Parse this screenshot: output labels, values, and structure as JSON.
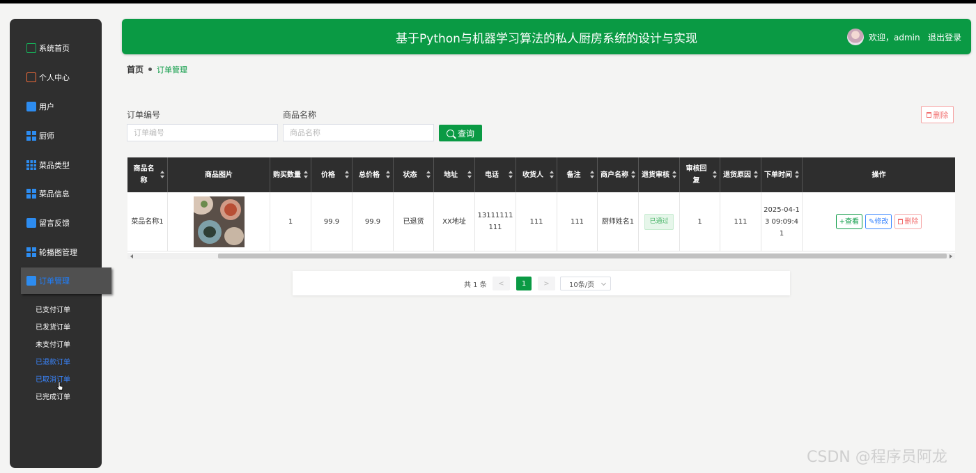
{
  "header": {
    "title": "基于Python与机器学习算法的私人厨房系统的设计与实现",
    "welcome": "欢迎，admin",
    "logout": "退出登录"
  },
  "sidebar": {
    "items": [
      {
        "label": "系统首页",
        "icon": "home-icon"
      },
      {
        "label": "个人中心",
        "icon": "card-icon"
      },
      {
        "label": "用户",
        "icon": "briefcase-icon"
      },
      {
        "label": "厨师",
        "icon": "grid-icon"
      },
      {
        "label": "菜品类型",
        "icon": "grid-icon"
      },
      {
        "label": "菜品信息",
        "icon": "grid-icon"
      },
      {
        "label": "留言反馈",
        "icon": "clipboard-icon"
      },
      {
        "label": "轮播图管理",
        "icon": "grid-icon"
      },
      {
        "label": "订单管理",
        "icon": "clipboard-icon"
      }
    ],
    "subitems": [
      "已支付订单",
      "已发货订单",
      "未支付订单",
      "已退款订单",
      "已取消订单",
      "已完成订单"
    ]
  },
  "breadcrumb": {
    "home": "首页",
    "current": "订单管理"
  },
  "search": {
    "order_no_label": "订单编号",
    "order_no_placeholder": "订单编号",
    "product_label": "商品名称",
    "product_placeholder": "商品名称",
    "search_button": "查询",
    "delete_button": "删除"
  },
  "table": {
    "headers": [
      "商品名称",
      "商品图片",
      "购买数量",
      "价格",
      "总价格",
      "状态",
      "地址",
      "电话",
      "收货人",
      "备注",
      "商户名称",
      "退货审核",
      "审核回复",
      "退货原因",
      "下单时间",
      "操作"
    ],
    "rows": [
      {
        "product_name": "菜品名称1",
        "quantity": "1",
        "price": "99.9",
        "total": "99.9",
        "status": "已退货",
        "address": "XX地址",
        "phone": "13111111111",
        "receiver": "111",
        "remark": "111",
        "merchant": "厨师姓名1",
        "return_review": "已通过",
        "review_reply": "1",
        "return_reason": "111",
        "order_time": "2025-04-13 09:09:41",
        "actions": {
          "view": "查看",
          "edit": "修改",
          "delete": "删除"
        }
      }
    ]
  },
  "pagination": {
    "total": "共 1 条",
    "prev": "<",
    "page": "1",
    "next": ">",
    "page_size": "10条/页"
  },
  "watermark": "CSDN @程序员阿龙",
  "colors": {
    "primary": "#0a9a44",
    "sidebar": "#2f2f2f",
    "link": "#3a86ff",
    "danger": "#f27070"
  }
}
